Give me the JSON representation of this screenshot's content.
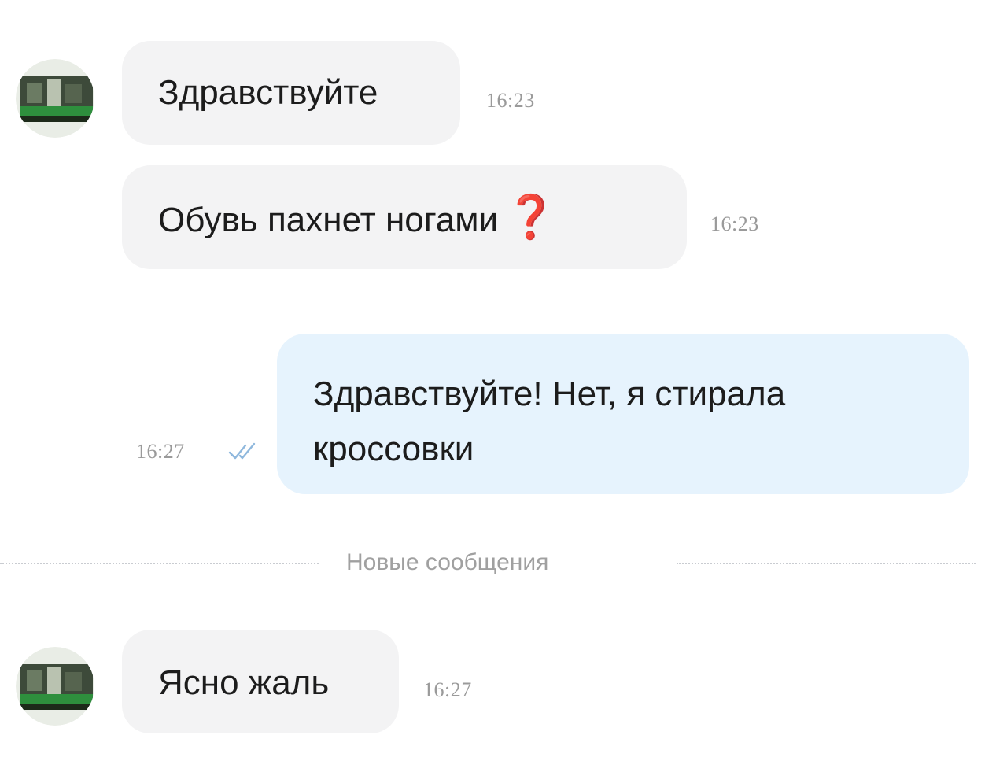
{
  "messages": [
    {
      "direction": "incoming",
      "text": "Здравствуйте",
      "time": "16:23"
    },
    {
      "direction": "incoming",
      "text": "Обувь пахнет ногами",
      "emoji": "❓",
      "time": "16:23"
    },
    {
      "direction": "outgoing",
      "lines": [
        "Здравствуйте! Нет, я стирала",
        "кроссовки"
      ],
      "time": "16:27",
      "status_icon": "double-check-icon"
    },
    {
      "direction": "incoming",
      "text": "Ясно жаль",
      "time": "16:27"
    }
  ],
  "divider": {
    "label": "Новые сообщения"
  },
  "colors": {
    "incoming_bubble": "#f3f3f4",
    "outgoing_bubble": "#e6f3fd",
    "timestamp": "#9a9a9a",
    "check_icon": "#8fb8dd",
    "question_mark": "#d33a31"
  },
  "icons": {
    "avatar": "contact-avatar",
    "read_status": "double-check-icon",
    "emoji": "red-question-mark-icon"
  }
}
